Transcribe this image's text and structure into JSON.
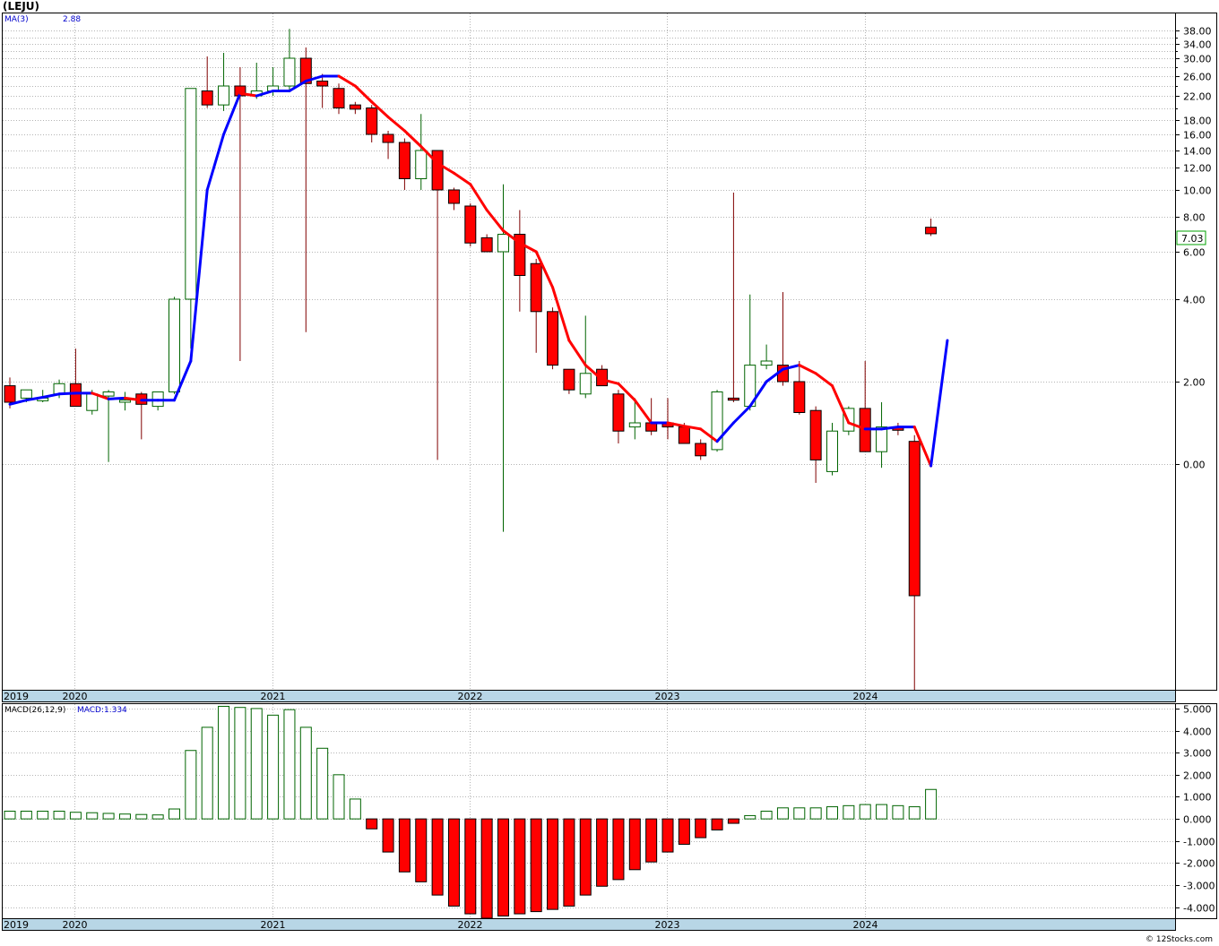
{
  "ticker_title": "(LEJU)",
  "legend": {
    "ma_label": "MA(3)",
    "ma_value": "2.88"
  },
  "macd_legend": {
    "label": "MACD(26,12,9)",
    "value_label": "MACD:1.334"
  },
  "current_price_label": "7.03",
  "watermark": "© 12Stocks.com",
  "colors": {
    "up": "#006400",
    "down": "#ff0000",
    "ma_up": "#0000ff",
    "ma_down": "#ff0000",
    "grid": "#b4b4b4",
    "axis_band": "#b8d6e6",
    "hist_up": "#006400",
    "hist_down": "#ff0000",
    "price_box": "#00a000"
  },
  "chart_data": [
    {
      "type": "candlestick",
      "title": "(LEJU)",
      "y_scale": "nonlinear (compressed below 0)",
      "y_ticks": [
        "38.00",
        "34.00",
        "30.00",
        "26.00",
        "22.00",
        "18.00",
        "16.00",
        "14.00",
        "12.00",
        "10.00",
        "8.00",
        "6.00",
        "4.00",
        "2.00",
        "0.00"
      ],
      "x_year_labels": [
        "2019",
        "2020",
        "2021",
        "2022",
        "2023",
        "2024"
      ],
      "candles": [
        {
          "o": 1.9,
          "h": 2.1,
          "l": 1.35,
          "c": 1.5
        },
        {
          "o": 1.6,
          "h": 1.8,
          "l": 1.5,
          "c": 1.8
        },
        {
          "o": 1.6,
          "h": 1.8,
          "l": 1.5,
          "c": 1.6
        },
        {
          "o": 1.7,
          "h": 2.05,
          "l": 1.6,
          "c": 1.95
        },
        {
          "o": 1.95,
          "h": 2.8,
          "l": 1.4,
          "c": 1.4
        },
        {
          "o": 1.3,
          "h": 1.8,
          "l": 1.2,
          "c": 1.7
        },
        {
          "o": 1.65,
          "h": 1.8,
          "l": 0.05,
          "c": 1.75
        },
        {
          "o": 1.5,
          "h": 1.75,
          "l": 1.3,
          "c": 1.55
        },
        {
          "o": 1.7,
          "h": 1.75,
          "l": 0.6,
          "c": 1.45
        },
        {
          "o": 1.4,
          "h": 1.75,
          "l": 1.3,
          "c": 1.75
        },
        {
          "o": 1.75,
          "h": 4.1,
          "l": 1.7,
          "c": 4.0
        },
        {
          "o": 4.0,
          "h": 7.0,
          "l": 2.8,
          "c": 23.5
        },
        {
          "o": 23.0,
          "h": 30.5,
          "l": 20.0,
          "c": 20.5
        },
        {
          "o": 20.5,
          "h": 31.5,
          "l": 19.5,
          "c": 24.0
        },
        {
          "o": 24.0,
          "h": 28.0,
          "l": 2.5,
          "c": 22.0
        },
        {
          "o": 22.0,
          "h": 29.0,
          "l": 21.5,
          "c": 23.0
        },
        {
          "o": 23.0,
          "h": 28.0,
          "l": 22.0,
          "c": 24.0
        },
        {
          "o": 24.0,
          "h": 38.5,
          "l": 23.0,
          "c": 30.0
        },
        {
          "o": 30.0,
          "h": 33.0,
          "l": 3.2,
          "c": 24.5
        },
        {
          "o": 25.0,
          "h": 26.5,
          "l": 20.0,
          "c": 24.0
        },
        {
          "o": 23.5,
          "h": 24.5,
          "l": 19.0,
          "c": 20.0
        },
        {
          "o": 20.5,
          "h": 21.0,
          "l": 19.0,
          "c": 19.8
        },
        {
          "o": 20.0,
          "h": 20.5,
          "l": 15.0,
          "c": 16.0
        },
        {
          "o": 16.0,
          "h": 16.5,
          "l": 13.0,
          "c": 15.0
        },
        {
          "o": 15.0,
          "h": 15.5,
          "l": 10.0,
          "c": 11.0
        },
        {
          "o": 11.0,
          "h": 19.0,
          "l": 10.0,
          "c": 14.0
        },
        {
          "o": 14.0,
          "h": 14.0,
          "l": 0.1,
          "c": 10.0
        },
        {
          "o": 10.0,
          "h": 10.2,
          "l": 8.5,
          "c": 9.0
        },
        {
          "o": 8.8,
          "h": 9.0,
          "l": 6.3,
          "c": 6.5
        },
        {
          "o": 6.8,
          "h": 7.0,
          "l": 6.0,
          "c": 6.0
        },
        {
          "o": 6.0,
          "h": 10.5,
          "l": -1.8,
          "c": 7.0
        },
        {
          "o": 7.0,
          "h": 8.5,
          "l": 3.7,
          "c": 5.0
        },
        {
          "o": 5.5,
          "h": 5.7,
          "l": 2.7,
          "c": 3.7
        },
        {
          "o": 3.7,
          "h": 3.8,
          "l": 2.3,
          "c": 2.4
        },
        {
          "o": 2.3,
          "h": 2.3,
          "l": 1.7,
          "c": 1.8
        },
        {
          "o": 1.7,
          "h": 3.6,
          "l": 1.6,
          "c": 2.2
        },
        {
          "o": 2.3,
          "h": 2.4,
          "l": 1.9,
          "c": 1.9
        },
        {
          "o": 1.7,
          "h": 1.8,
          "l": 0.5,
          "c": 0.8
        },
        {
          "o": 0.9,
          "h": 1.6,
          "l": 0.6,
          "c": 1.0
        },
        {
          "o": 1.0,
          "h": 1.6,
          "l": 0.7,
          "c": 0.8
        },
        {
          "o": 1.0,
          "h": 1.6,
          "l": 0.6,
          "c": 0.9
        },
        {
          "o": 0.9,
          "h": 1.0,
          "l": 0.6,
          "c": 0.5
        },
        {
          "o": 0.5,
          "h": 0.6,
          "l": 0.1,
          "c": 0.2
        },
        {
          "o": 0.35,
          "h": 1.8,
          "l": 0.3,
          "c": 1.75
        },
        {
          "o": 1.6,
          "h": 9.8,
          "l": 1.5,
          "c": 1.55
        },
        {
          "o": 1.4,
          "h": 4.2,
          "l": 1.3,
          "c": 2.4
        },
        {
          "o": 2.4,
          "h": 2.9,
          "l": 2.3,
          "c": 2.5
        },
        {
          "o": 2.4,
          "h": 4.3,
          "l": 1.9,
          "c": 2.0
        },
        {
          "o": 2.0,
          "h": 2.5,
          "l": 1.2,
          "c": 1.25
        },
        {
          "o": 1.3,
          "h": 1.4,
          "l": -0.5,
          "c": 0.1
        },
        {
          "o": -0.2,
          "h": 1.0,
          "l": -0.3,
          "c": 0.8
        },
        {
          "o": 0.8,
          "h": 1.4,
          "l": 0.7,
          "c": 1.35
        },
        {
          "o": 1.35,
          "h": 2.5,
          "l": 0.6,
          "c": 0.3
        },
        {
          "o": 0.3,
          "h": 1.5,
          "l": -0.1,
          "c": 0.9
        },
        {
          "o": 0.9,
          "h": 1.0,
          "l": 0.7,
          "c": 0.82
        },
        {
          "o": 0.55,
          "h": 0.7,
          "l": -6.0,
          "c": -3.5
        },
        {
          "o": 7.4,
          "h": 7.9,
          "l": 6.9,
          "c": 7.03
        }
      ],
      "ma3": [
        1.45,
        1.55,
        1.62,
        1.7,
        1.72,
        1.72,
        1.58,
        1.6,
        1.55,
        1.55,
        1.55,
        2.5,
        10.0,
        16.0,
        22.5,
        22.0,
        23.0,
        23.0,
        25.0,
        26.0,
        26.0,
        24.0,
        21.0,
        18.5,
        16.5,
        14.5,
        12.5,
        11.5,
        10.5,
        8.5,
        7.2,
        6.5,
        6.0,
        4.5,
        3.0,
        2.4,
        2.05,
        1.95,
        1.55,
        1.0,
        1.0,
        0.92,
        0.85,
        0.55,
        1.0,
        1.4,
        2.0,
        2.3,
        2.4,
        2.2,
        1.9,
        1.0,
        0.85,
        0.85,
        0.9,
        0.9,
        -0.05,
        3.0
      ]
    },
    {
      "type": "bar",
      "title": "MACD(26,12,9)",
      "y_ticks": [
        "5.000",
        "4.000",
        "3.000",
        "2.000",
        "1.000",
        "0.000",
        "-1.000",
        "-2.000",
        "-3.000",
        "-4.000"
      ],
      "ylim": [
        -4.5,
        5.2
      ],
      "values": [
        0.35,
        0.35,
        0.35,
        0.35,
        0.3,
        0.28,
        0.25,
        0.22,
        0.2,
        0.18,
        0.45,
        3.1,
        4.15,
        5.1,
        5.05,
        5.0,
        4.7,
        4.95,
        4.15,
        3.2,
        2.0,
        0.9,
        -0.45,
        -1.5,
        -2.4,
        -2.85,
        -3.45,
        -3.95,
        -4.3,
        -4.5,
        -4.4,
        -4.3,
        -4.2,
        -4.1,
        -3.95,
        -3.45,
        -3.05,
        -2.75,
        -2.3,
        -1.95,
        -1.5,
        -1.15,
        -0.85,
        -0.5,
        -0.2,
        0.15,
        0.35,
        0.5,
        0.5,
        0.5,
        0.55,
        0.6,
        0.65,
        0.65,
        0.6,
        0.55,
        1.334
      ]
    }
  ]
}
